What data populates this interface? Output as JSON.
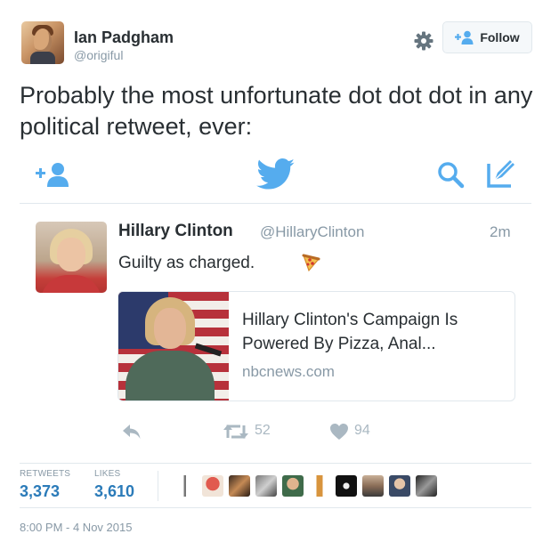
{
  "colors": {
    "accent": "#55acee",
    "link": "#2b7bb9",
    "muted": "#8899a6",
    "icon_muted": "#aab8c2"
  },
  "author": {
    "name": "Ian Padgham",
    "handle": "@origiful",
    "avatar_icon": "user-avatar"
  },
  "follow_button": {
    "label": "Follow",
    "icon": "add-user-icon"
  },
  "settings_icon": "gear-icon",
  "tweet": {
    "text": "Probably the most unfortunate dot dot dot in any political retweet, ever:"
  },
  "action_bar": {
    "icons": [
      "add-user-icon",
      "twitter-bird-icon",
      "search-icon",
      "compose-icon"
    ]
  },
  "quoted_tweet": {
    "name": "Hillary Clinton",
    "handle": "@HillaryClinton",
    "time": "2m",
    "text": "Guilty as charged.",
    "emoji": "pizza-icon",
    "card": {
      "title": "Hillary Clinton's Campaign Is Powered By Pizza, Anal...",
      "domain": "nbcnews.com"
    },
    "actions": {
      "retweets": "52",
      "likes": "94"
    }
  },
  "stats": {
    "retweets_label": "RETWEETS",
    "retweets_value": "3,373",
    "likes_label": "LIKES",
    "likes_value": "3,610",
    "liker_avatars": 10
  },
  "timestamp": "8:00 PM - 4 Nov 2015"
}
